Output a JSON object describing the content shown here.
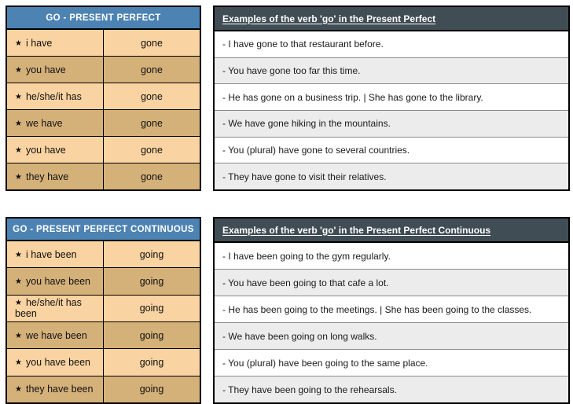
{
  "colors": {
    "conj_header_blue": "#4d83b3",
    "examples_header_slate": "#414d55",
    "row_tan_light": "#f9d3a1",
    "row_tan_dark": "#d5b17a",
    "row_gray_light": "#ececec",
    "row_white": "#ffffff",
    "border_black": "#000000"
  },
  "icons": {
    "bullet_star": "★"
  },
  "sections": [
    {
      "id": "present-perfect",
      "conjugation": {
        "header": "GO - PRESENT PERFECT",
        "rows": [
          {
            "pronoun": "i have",
            "form": "gone"
          },
          {
            "pronoun": "you have",
            "form": "gone"
          },
          {
            "pronoun": "he/she/it has",
            "form": "gone"
          },
          {
            "pronoun": "we have",
            "form": "gone"
          },
          {
            "pronoun": "you have",
            "form": "gone"
          },
          {
            "pronoun": "they have",
            "form": "gone"
          }
        ]
      },
      "examples": {
        "header": "Examples of the verb 'go' in the Present Perfect",
        "rows": [
          "- I have gone to that restaurant before.",
          "- You have gone too far this time.",
          "- He has gone on a business trip. | She has gone to the library.",
          "- We have gone hiking in the mountains.",
          "- You (plural) have gone to several countries.",
          "- They have gone to visit their relatives."
        ]
      }
    },
    {
      "id": "present-perfect-continuous",
      "conjugation": {
        "header": "GO - PRESENT PERFECT CONTINUOUS",
        "rows": [
          {
            "pronoun": "i have been",
            "form": "going"
          },
          {
            "pronoun": "you have been",
            "form": "going"
          },
          {
            "pronoun": "he/she/it has been",
            "form": "going"
          },
          {
            "pronoun": "we have been",
            "form": "going"
          },
          {
            "pronoun": "you have been",
            "form": "going"
          },
          {
            "pronoun": "they have been",
            "form": "going"
          }
        ]
      },
      "examples": {
        "header": "Examples of the verb 'go' in the Present Perfect Continuous",
        "rows": [
          "- I have been going to the gym regularly.",
          "- You have been going to that cafe a lot.",
          "- He has been going to the meetings. | She has been going to the classes.",
          "- We have been going on long walks.",
          "- You (plural) have been going to the same place.",
          "- They have been going to the rehearsals."
        ]
      }
    }
  ]
}
